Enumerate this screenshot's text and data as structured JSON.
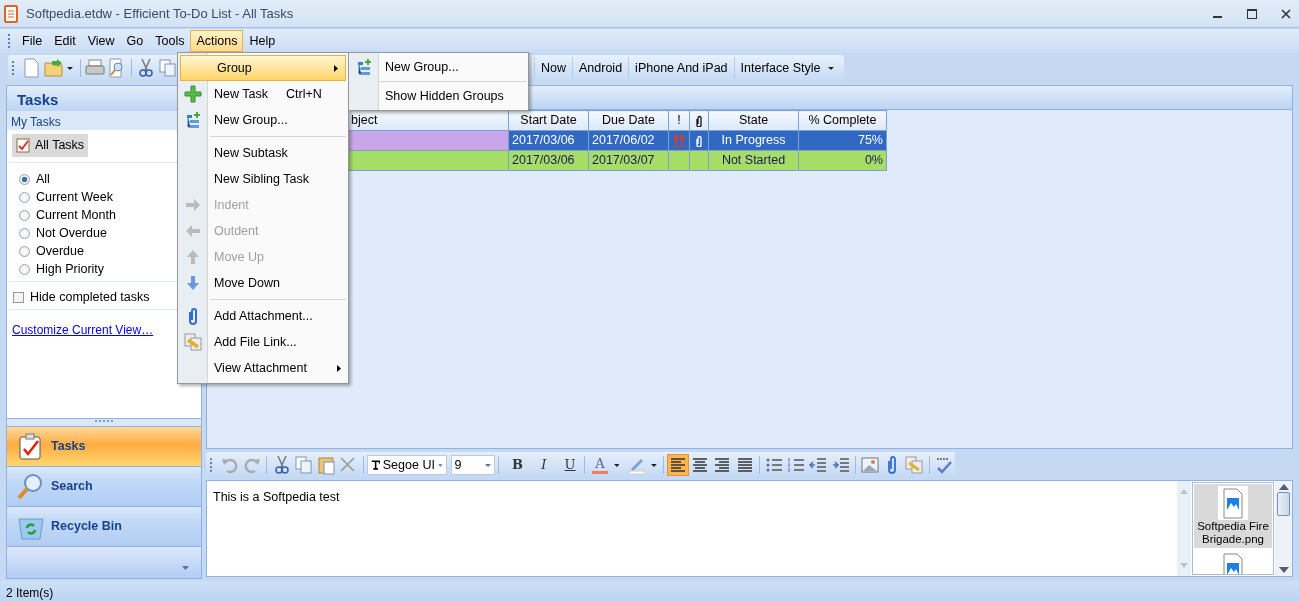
{
  "window": {
    "title": "Softpedia.etdw - Efficient To-Do List - All Tasks"
  },
  "menu_bar": [
    {
      "label": "File",
      "selected": false
    },
    {
      "label": "Edit",
      "selected": false
    },
    {
      "label": "View",
      "selected": false
    },
    {
      "label": "Go",
      "selected": false
    },
    {
      "label": "Tools",
      "selected": false
    },
    {
      "label": "Actions",
      "selected": true
    },
    {
      "label": "Help",
      "selected": false
    }
  ],
  "toolbar": {
    "buttons": [
      {
        "label": "Now",
        "dropdown": false
      },
      {
        "label": "Android",
        "dropdown": false
      },
      {
        "label": "iPhone And iPad",
        "dropdown": false
      },
      {
        "label": "Interface Style",
        "dropdown": true
      }
    ]
  },
  "actions_menu": [
    {
      "kind": "item",
      "label": "Group",
      "selected": true,
      "disabled": false,
      "submenu": true
    },
    {
      "kind": "item",
      "label": "New Task",
      "shortcut": "Ctrl+N",
      "selected": false,
      "disabled": false,
      "submenu": false
    },
    {
      "kind": "item",
      "label": "New Group...",
      "selected": false,
      "disabled": false,
      "submenu": false
    },
    {
      "kind": "separator"
    },
    {
      "kind": "item",
      "label": "New Subtask",
      "selected": false,
      "disabled": false,
      "submenu": false
    },
    {
      "kind": "item",
      "label": "New Sibling Task",
      "selected": false,
      "disabled": false,
      "submenu": false
    },
    {
      "kind": "item",
      "label": "Indent",
      "selected": false,
      "disabled": true,
      "submenu": false
    },
    {
      "kind": "item",
      "label": "Outdent",
      "selected": false,
      "disabled": true,
      "submenu": false
    },
    {
      "kind": "item",
      "label": "Move Up",
      "selected": false,
      "disabled": true,
      "submenu": false
    },
    {
      "kind": "item",
      "label": "Move Down",
      "selected": false,
      "disabled": false,
      "submenu": false
    },
    {
      "kind": "separator"
    },
    {
      "kind": "item",
      "label": "Add Attachment...",
      "selected": false,
      "disabled": false,
      "submenu": false
    },
    {
      "kind": "item",
      "label": "Add File Link...",
      "selected": false,
      "disabled": false,
      "submenu": false
    },
    {
      "kind": "item",
      "label": "View Attachment",
      "selected": false,
      "disabled": false,
      "submenu": true
    }
  ],
  "group_submenu": [
    {
      "kind": "item",
      "label": "New Group..."
    },
    {
      "kind": "separator"
    },
    {
      "kind": "item",
      "label": "Show Hidden Groups"
    }
  ],
  "sidebar": {
    "title": "Tasks",
    "section": "My Tasks",
    "view_button": "All Tasks",
    "filters": [
      {
        "label": "All",
        "selected": true
      },
      {
        "label": "Current Week",
        "selected": false
      },
      {
        "label": "Current Month",
        "selected": false
      },
      {
        "label": "Not Overdue",
        "selected": false
      },
      {
        "label": "Overdue",
        "selected": false
      },
      {
        "label": "High Priority",
        "selected": false
      }
    ],
    "hide_completed": {
      "label": "Hide completed tasks",
      "checked": false
    },
    "customize_link": "Customize Current View…",
    "nav": [
      {
        "label": "Tasks",
        "selected": true
      },
      {
        "label": "Search",
        "selected": false
      },
      {
        "label": "Recycle Bin",
        "selected": false
      }
    ]
  },
  "task_table": {
    "columns": [
      {
        "kind": "text",
        "label": "bject"
      },
      {
        "kind": "text",
        "label": "Start Date"
      },
      {
        "kind": "text",
        "label": "Due Date"
      },
      {
        "kind": "text",
        "label": "!"
      },
      {
        "kind": "icon"
      },
      {
        "kind": "text",
        "label": "State"
      },
      {
        "kind": "text",
        "label": "% Complete"
      }
    ],
    "rows": [
      {
        "selected": true,
        "color": "#c9a6ea",
        "start_date": "2017/03/06",
        "due_date": "2017/06/02",
        "high_priority": true,
        "has_attachment": true,
        "state": "In Progress",
        "percent": "75%"
      },
      {
        "selected": false,
        "color": "#a6dd66",
        "start_date": "2017/03/06",
        "due_date": "2017/03/07",
        "high_priority": false,
        "has_attachment": false,
        "state": "Not Started",
        "percent": "0%"
      }
    ]
  },
  "editor": {
    "undo_disabled": true,
    "redo_disabled": true,
    "font": "Segoe UI",
    "size": "9",
    "format_buttons": [
      "B",
      "I",
      "U"
    ],
    "font_color_label": "A",
    "align": [
      {
        "selected": true
      },
      {
        "selected": false
      },
      {
        "selected": false
      },
      {
        "selected": false
      }
    ],
    "text": "This is a Softpedia test",
    "attachments": [
      {
        "name": "Softpedia Fire Brigade.png",
        "selected": true
      },
      {
        "selected": false
      }
    ]
  },
  "status_bar": "2 Item(s)"
}
